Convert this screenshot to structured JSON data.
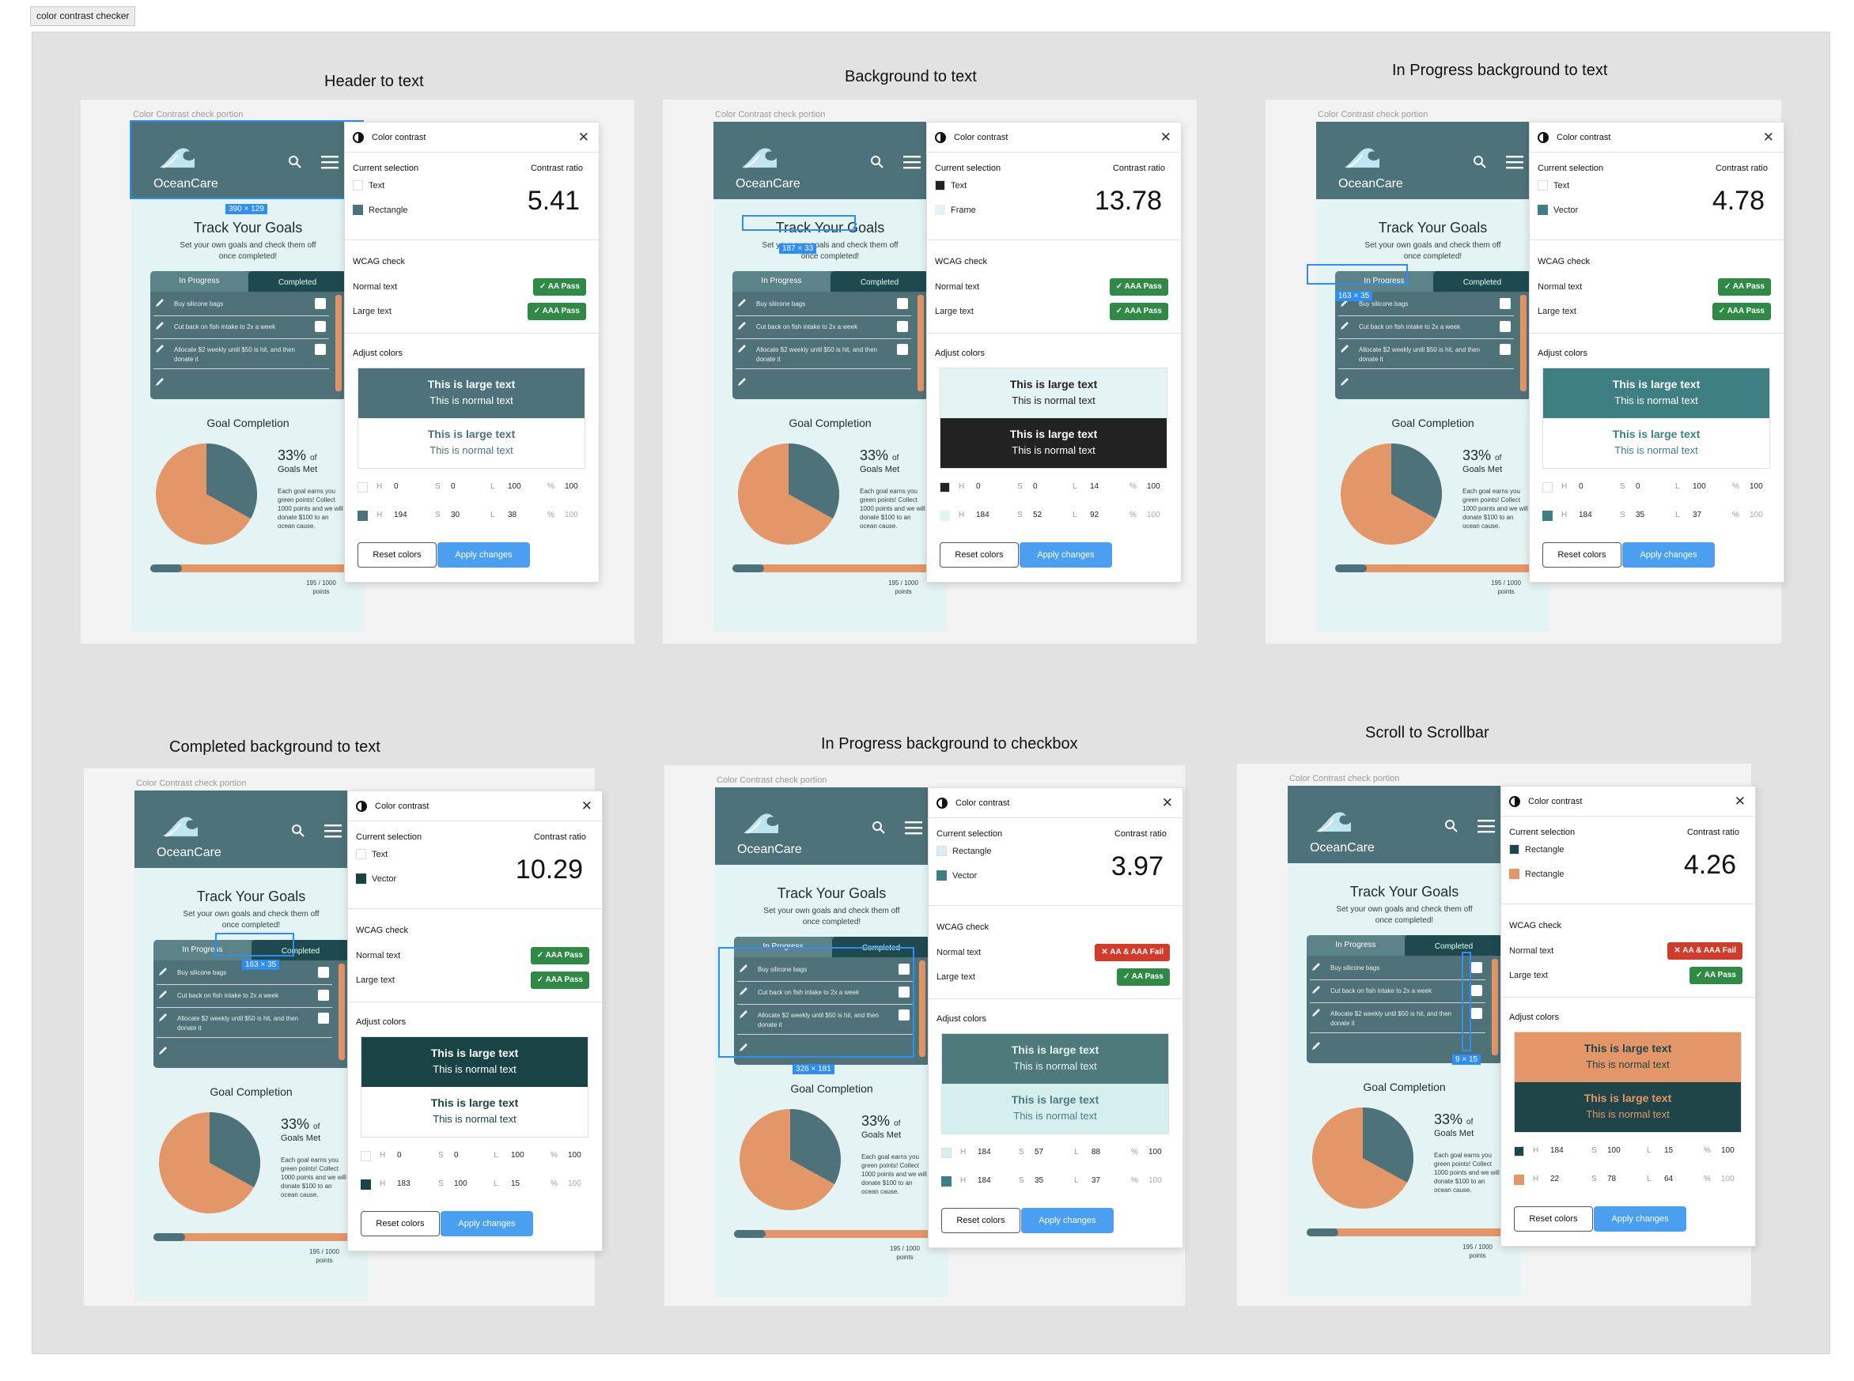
{
  "top_label": "color contrast checker",
  "panels": [
    {
      "title": "Header to text",
      "caption": "Color Contrast check portion",
      "sel_dims": "390 × 129",
      "sel_a": "Text",
      "sel_b": "Rectangle",
      "sw_a": "#ffffff",
      "sw_b": "#4e7279",
      "ratio": "5.41",
      "normal_badge": "AA Pass",
      "normal_pass": true,
      "large_badge": "AAA Pass",
      "large_pass": true,
      "prev1_bg": "#4e7279",
      "prev1_fg": "#ffffff",
      "prev2_bg": "#ffffff",
      "prev2_fg": "#4e7279",
      "hsl_a": [
        "0",
        "0",
        "100",
        "100"
      ],
      "hsl_b": [
        "194",
        "30",
        "38",
        "100"
      ]
    },
    {
      "title": "Background to text",
      "caption": "Color Contrast check portion",
      "sel_dims": "187 × 33",
      "sel_a": "Text",
      "sel_b": "Frame",
      "sw_a": "#222222",
      "sw_b": "#e4f3f3",
      "ratio": "13.78",
      "normal_badge": "AAA Pass",
      "normal_pass": true,
      "large_badge": "AAA Pass",
      "large_pass": true,
      "prev1_bg": "#e4f3f3",
      "prev1_fg": "#222222",
      "prev2_bg": "#222222",
      "prev2_fg": "#ffffff",
      "hsl_a": [
        "0",
        "0",
        "14",
        "100"
      ],
      "hsl_b": [
        "184",
        "52",
        "92",
        "100"
      ]
    },
    {
      "title": "In Progress background to text",
      "caption": "Color Contrast check portion",
      "sel_dims": "163 × 35",
      "sel_a": "Text",
      "sel_b": "Vector",
      "sw_a": "#ffffff",
      "sw_b": "#3d7f83",
      "ratio": "4.78",
      "normal_badge": "AA Pass",
      "normal_pass": true,
      "large_badge": "AAA Pass",
      "large_pass": true,
      "prev1_bg": "#3d7f83",
      "prev1_fg": "#ffffff",
      "prev2_bg": "#ffffff",
      "prev2_fg": "#3d7f83",
      "hsl_a": [
        "0",
        "0",
        "100",
        "100"
      ],
      "hsl_b": [
        "184",
        "35",
        "37",
        "100"
      ]
    },
    {
      "title": "Completed background to text",
      "caption": "Color Contrast check portion",
      "sel_dims": "163 × 35",
      "sel_a": "Text",
      "sel_b": "Vector",
      "sw_a": "#ffffff",
      "sw_b": "#1a4346",
      "ratio": "10.29",
      "normal_badge": "AAA Pass",
      "normal_pass": true,
      "large_badge": "AAA Pass",
      "large_pass": true,
      "prev1_bg": "#1a4346",
      "prev1_fg": "#ffffff",
      "prev2_bg": "#ffffff",
      "prev2_fg": "#1a4346",
      "hsl_a": [
        "0",
        "0",
        "100",
        "100"
      ],
      "hsl_b": [
        "183",
        "100",
        "15",
        "100"
      ]
    },
    {
      "title": "In Progress background to checkbox",
      "caption": "Color Contrast check portion",
      "sel_dims": "326 × 181",
      "sel_a": "Rectangle",
      "sel_b": "Vector",
      "sw_a": "#d8eff0",
      "sw_b": "#3d7f83",
      "ratio": "3.97",
      "normal_badge": "AA & AAA Fail",
      "normal_pass": false,
      "large_badge": "AA Pass",
      "large_pass": true,
      "prev1_bg": "#4e7a7c",
      "prev1_fg": "#e4f3f3",
      "prev2_bg": "#d4eeee",
      "prev2_fg": "#4e7a7c",
      "hsl_a": [
        "184",
        "57",
        "88",
        "100"
      ],
      "hsl_b": [
        "184",
        "35",
        "37",
        "100"
      ]
    },
    {
      "title": "Scroll to Scrollbar",
      "caption": "Color Contrast check portion",
      "sel_dims": "9 × 15",
      "sel_a": "Rectangle",
      "sel_b": "Rectangle",
      "sw_a": "#1f4548",
      "sw_b": "#e39667",
      "ratio": "4.26",
      "normal_badge": "AA & AAA Fail",
      "normal_pass": false,
      "large_badge": "AA Pass",
      "large_pass": true,
      "prev1_bg": "#e39667",
      "prev1_fg": "#1f4548",
      "prev2_bg": "#1f4548",
      "prev2_fg": "#e39667",
      "hsl_a": [
        "184",
        "100",
        "15",
        "100"
      ],
      "hsl_b": [
        "22",
        "78",
        "64",
        "100"
      ]
    }
  ],
  "dialog": {
    "title": "Color contrast",
    "current_selection": "Current selection",
    "contrast_ratio": "Contrast ratio",
    "wcag_check": "WCAG check",
    "normal_text": "Normal text",
    "large_text": "Large text",
    "adjust_colors": "Adjust colors",
    "preview_large": "This is large text",
    "preview_normal": "This is normal text",
    "h": "H",
    "s": "S",
    "l": "L",
    "pct": "%",
    "reset": "Reset colors",
    "apply": "Apply changes"
  },
  "mock": {
    "brand": "OceanCare",
    "heading": "Track Your Goals",
    "subtitle": "Set your own goals and check them off once completed!",
    "tab_in_progress": "In Progress",
    "tab_completed": "Completed",
    "goals": [
      "Buy silicone bags",
      "Cut back on fish intake to 2x a week",
      "Allocate $2 weekly until $50 is hit, and then donate it"
    ],
    "goal_completion": "Goal Completion",
    "percent": "33%",
    "of": "of",
    "goals_met": "Goals Met",
    "note": "Each goal earns you green points! Collect 1000 points and we will donate $100 to an ocean cause.",
    "points": "195 / 1000 points",
    "pie_values": [
      33,
      67
    ]
  },
  "colors": {
    "header_teal": "#4e7279",
    "frame_bg": "#e4f3f3",
    "accent_orange": "#e39667",
    "completed_tab": "#1e4a4f",
    "apply_blue": "#4a9ff0",
    "pass_green": "#2f8a45",
    "fail_red": "#d13b2a"
  }
}
